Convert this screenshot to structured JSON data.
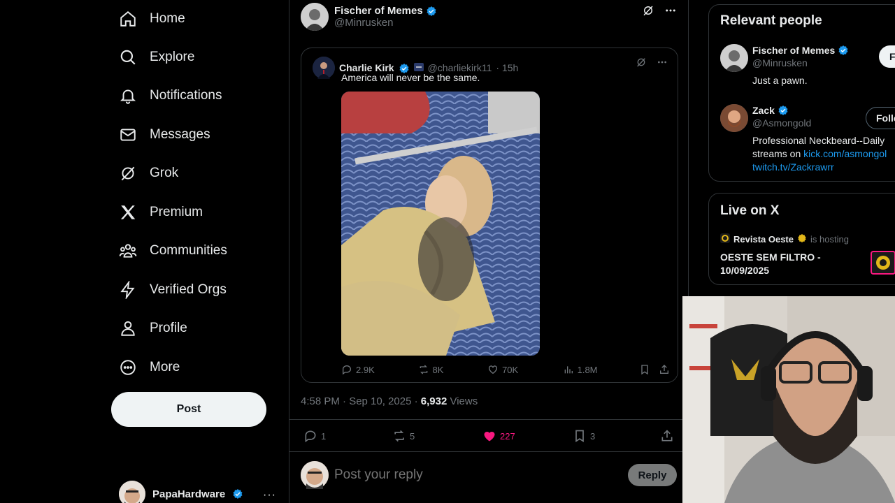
{
  "nav": {
    "items": [
      {
        "label": "Home",
        "icon": "home-icon"
      },
      {
        "label": "Explore",
        "icon": "search-icon"
      },
      {
        "label": "Notifications",
        "icon": "bell-icon"
      },
      {
        "label": "Messages",
        "icon": "envelope-icon"
      },
      {
        "label": "Grok",
        "icon": "grok-icon"
      },
      {
        "label": "Premium",
        "icon": "x-logo-icon"
      },
      {
        "label": "Communities",
        "icon": "people-icon"
      },
      {
        "label": "Verified Orgs",
        "icon": "lightning-icon"
      },
      {
        "label": "Profile",
        "icon": "person-icon"
      },
      {
        "label": "More",
        "icon": "more-circle-icon"
      }
    ],
    "post_label": "Post",
    "account_name": "PapaHardware",
    "account_more": "···"
  },
  "tweet": {
    "author_name": "Fischer of Memes",
    "author_handle": "@Minrusken",
    "quote": {
      "name": "Charlie Kirk",
      "handle": "@charliekirk11",
      "time": "· 15h",
      "text": "America will never be the same.",
      "replies": "2.9K",
      "reposts": "8K",
      "likes": "70K",
      "views": "1.8M"
    },
    "timestamp": "4:58 PM · Sep 10, 2025 · ",
    "views_count": "6,932",
    "views_label": " Views",
    "replies": "1",
    "reposts": "5",
    "likes": "227",
    "bookmarks": "3",
    "reply_placeholder": "Post your reply",
    "reply_label": "Reply"
  },
  "relevant": {
    "title": "Relevant people",
    "people": [
      {
        "name": "Fischer of Memes",
        "handle": "@Minrusken",
        "bio": "Just a pawn.",
        "follow": "F"
      },
      {
        "name": "Zack",
        "handle": "@Asmongold",
        "bio_prefix": "Professional Neckbeard--Daily",
        "bio_line2": "streams on ",
        "bio_link1": "kick.com/asmongol",
        "bio_link2": "twitch.tv/Zackrawrr",
        "follow": "Follo"
      }
    ]
  },
  "live": {
    "title": "Live on X",
    "host": "Revista Oeste",
    "hosting": "is hosting",
    "space_title_1": "OESTE SEM FILTRO -",
    "space_title_2": "10/09/2025"
  },
  "colors": {
    "verified": "#1d9bf0",
    "like": "#f91880",
    "gold": "#e2b719"
  }
}
